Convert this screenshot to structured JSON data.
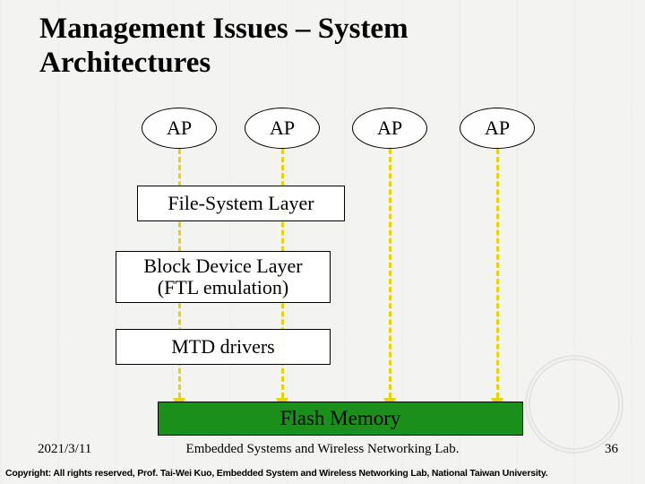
{
  "title": "Management Issues – System Architectures",
  "nodes": {
    "ap1": "AP",
    "ap2": "AP",
    "ap3": "AP",
    "ap4": "AP",
    "fs_layer": "File-System Layer",
    "block_layer_l1": "Block Device Layer",
    "block_layer_l2": "(FTL emulation)",
    "mtd": "MTD drivers",
    "flash": "Flash Memory"
  },
  "footer": {
    "date": "2021/3/11",
    "lab": "Embedded Systems and Wireless Networking Lab.",
    "page": "36",
    "copyright": "Copyright: All rights reserved, Prof. Tai-Wei Kuo, Embedded System and Wireless Networking Lab, National Taiwan University."
  },
  "arrows": {
    "count": 4,
    "style": "dashed-yellow",
    "from": "AP ellipses",
    "to": "Flash Memory"
  }
}
